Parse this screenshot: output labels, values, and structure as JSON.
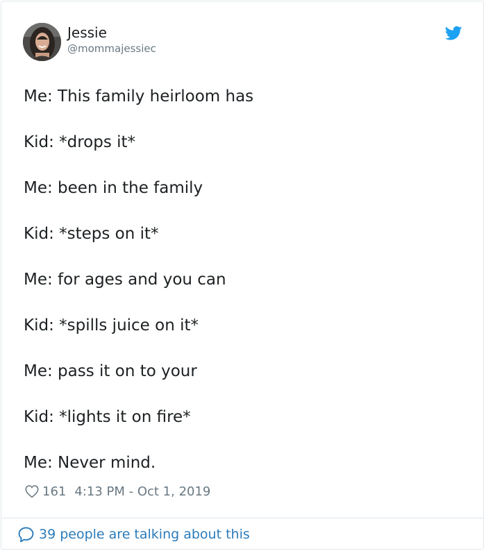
{
  "author": {
    "name": "Jessie",
    "handle": "@mommajessiec"
  },
  "icons": {
    "brand": "twitter-bird-icon",
    "like": "heart-icon",
    "reply": "speech-bubble-icon"
  },
  "colors": {
    "twitter_blue": "#1da1f2",
    "link_blue": "#2b7bb9",
    "meta_gray": "#697882",
    "text": "#1c2022"
  },
  "tweet": {
    "lines": [
      "Me: This family heirloom has",
      "Kid: *drops it*",
      "Me: been in the family",
      "Kid: *steps on it*",
      "Me: for ages and you can",
      "Kid: *spills juice on it*",
      "Me: pass it on to your",
      "Kid: *lights it on fire*",
      "Me: Never mind."
    ],
    "likes": "161",
    "timestamp": "4:13 PM - Oct 1, 2019"
  },
  "footer": {
    "talking": "39 people are talking about this"
  }
}
